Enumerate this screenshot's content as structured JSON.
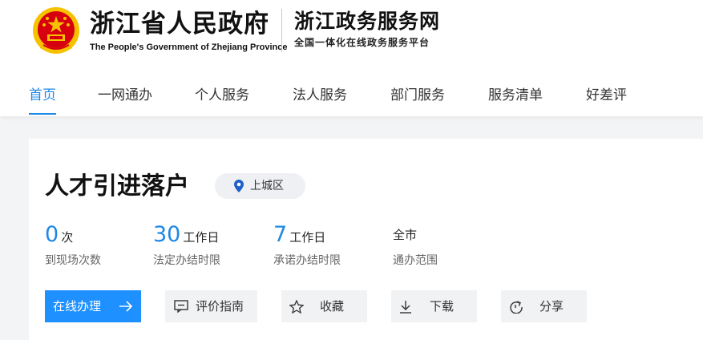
{
  "header": {
    "gov_title": "浙江省人民政府",
    "gov_subtitle": "The People's Government of Zhejiang Province",
    "portal_title": "浙江政务服务网",
    "portal_subtitle": "全国一体化在线政务服务平台"
  },
  "nav": {
    "items": [
      {
        "label": "首页",
        "active": true
      },
      {
        "label": "一网通办"
      },
      {
        "label": "个人服务"
      },
      {
        "label": "法人服务"
      },
      {
        "label": "部门服务"
      },
      {
        "label": "服务清单"
      },
      {
        "label": "好差评"
      }
    ]
  },
  "service": {
    "title": "人才引进落户",
    "region": "上城区",
    "stats": [
      {
        "value": "0",
        "unit": "次",
        "label": "到现场次数"
      },
      {
        "value": "30",
        "unit": "工作日",
        "label": "法定办结时限"
      },
      {
        "value": "7",
        "unit": "工作日",
        "label": "承诺办结时限"
      },
      {
        "value": "全市",
        "label": "通办范围"
      }
    ]
  },
  "actions": {
    "online": "在线办理",
    "guide": "评价指南",
    "favorite": "收藏",
    "download": "下载",
    "share": "分享"
  },
  "colors": {
    "accent": "#1e88e5",
    "primary_button": "#1e90ff",
    "emblem_red": "#d7000f",
    "emblem_gold": "#f6c200"
  }
}
